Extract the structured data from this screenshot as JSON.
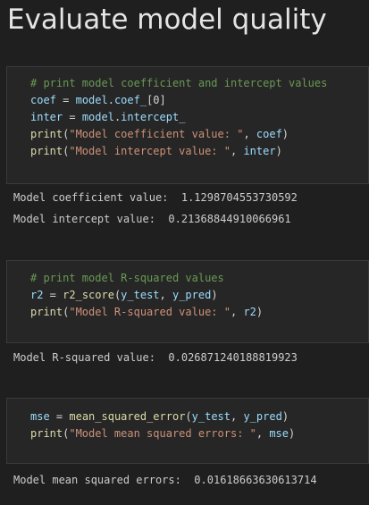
{
  "page": {
    "title": "Evaluate model quality"
  },
  "cells": [
    {
      "code": [
        [
          {
            "t": "# print model coefficient and intercept values",
            "c": "comment"
          }
        ],
        [
          {
            "t": "coef",
            "c": "var"
          },
          {
            "t": " = ",
            "c": "op"
          },
          {
            "t": "model",
            "c": "var"
          },
          {
            "t": ".",
            "c": "op"
          },
          {
            "t": "coef_",
            "c": "var"
          },
          {
            "t": "[0]",
            "c": "plain"
          }
        ],
        [
          {
            "t": "inter",
            "c": "var"
          },
          {
            "t": " = ",
            "c": "op"
          },
          {
            "t": "model",
            "c": "var"
          },
          {
            "t": ".",
            "c": "op"
          },
          {
            "t": "intercept_",
            "c": "var"
          }
        ],
        [
          {
            "t": "print",
            "c": "func"
          },
          {
            "t": "(",
            "c": "plain"
          },
          {
            "t": "\"Model coefficient value: \"",
            "c": "str"
          },
          {
            "t": ", ",
            "c": "plain"
          },
          {
            "t": "coef",
            "c": "var"
          },
          {
            "t": ")",
            "c": "plain"
          }
        ],
        [
          {
            "t": "print",
            "c": "func"
          },
          {
            "t": "(",
            "c": "plain"
          },
          {
            "t": "\"Model intercept value: \"",
            "c": "str"
          },
          {
            "t": ", ",
            "c": "plain"
          },
          {
            "t": "inter",
            "c": "var"
          },
          {
            "t": ")",
            "c": "plain"
          }
        ]
      ],
      "output": [
        "Model coefficient value:  1.1298704553730592",
        "Model intercept value:  0.21368844910066961"
      ]
    },
    {
      "code": [
        [
          {
            "t": "# print model R-squared values",
            "c": "comment"
          }
        ],
        [
          {
            "t": "r2",
            "c": "var"
          },
          {
            "t": " = ",
            "c": "op"
          },
          {
            "t": "r2_score",
            "c": "func"
          },
          {
            "t": "(",
            "c": "plain"
          },
          {
            "t": "y_test",
            "c": "var"
          },
          {
            "t": ", ",
            "c": "plain"
          },
          {
            "t": "y_pred",
            "c": "var"
          },
          {
            "t": ")",
            "c": "plain"
          }
        ],
        [
          {
            "t": "print",
            "c": "func"
          },
          {
            "t": "(",
            "c": "plain"
          },
          {
            "t": "\"Model R-squared value: \"",
            "c": "str"
          },
          {
            "t": ", ",
            "c": "plain"
          },
          {
            "t": "r2",
            "c": "var"
          },
          {
            "t": ")",
            "c": "plain"
          }
        ]
      ],
      "output": [
        "Model R-squared value:  0.026871240188819923"
      ]
    },
    {
      "code": [
        [
          {
            "t": "mse",
            "c": "var"
          },
          {
            "t": " = ",
            "c": "op"
          },
          {
            "t": "mean_squared_error",
            "c": "func"
          },
          {
            "t": "(",
            "c": "plain"
          },
          {
            "t": "y_test",
            "c": "var"
          },
          {
            "t": ", ",
            "c": "plain"
          },
          {
            "t": "y_pred",
            "c": "var"
          },
          {
            "t": ")",
            "c": "plain"
          }
        ],
        [
          {
            "t": "print",
            "c": "func"
          },
          {
            "t": "(",
            "c": "plain"
          },
          {
            "t": "\"Model mean squared errors: \"",
            "c": "str"
          },
          {
            "t": ", ",
            "c": "plain"
          },
          {
            "t": "mse",
            "c": "var"
          },
          {
            "t": ")",
            "c": "plain"
          }
        ]
      ],
      "output": [
        "Model mean squared errors:  0.01618663630613714"
      ]
    }
  ],
  "colors": {
    "background": "#1f1f1f",
    "cell_background": "#262626",
    "comment": "#6a9955",
    "variable": "#9cdcfe",
    "function": "#dcdcaa",
    "string": "#ce9178",
    "text": "#d4d4d4"
  }
}
